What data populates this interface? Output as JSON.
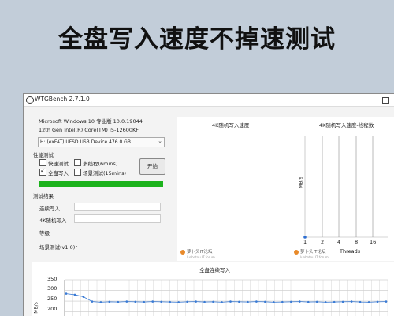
{
  "banner": {
    "title": "全盘写入速度不掉速测试"
  },
  "window": {
    "title": "WTGBench 2.7.1.0"
  },
  "system": {
    "os": "Microsoft Windows 10 专业版 10.0.19044",
    "cpu": "12th Gen Intel(R) Core(TM) i5-12600KF",
    "drive": "H:  (exFAT)   UFSD  USB Device 476.0 GB"
  },
  "test_type": {
    "section_label": "性能测试",
    "options": [
      {
        "label": "快速测试",
        "checked": false
      },
      {
        "label": "多线程(6mins)",
        "checked": false
      },
      {
        "label": "全盘写入",
        "checked": true
      },
      {
        "label": "场景测试(15mins)",
        "checked": false
      }
    ],
    "start_label": "开始",
    "progress": 1.0,
    "progress_color": "#1cb21c"
  },
  "results": {
    "section_label": "测试结果",
    "seq_write_label": "连续写入",
    "rand4k_write_label": "4K随机写入",
    "grade_label": "等级",
    "scene_label": "场景测试(v1.0)",
    "scene_value": "-"
  },
  "chart_4k": {
    "title": "4K随机写入速度"
  },
  "chart_threads": {
    "title": "4K随机写入速度-线程数",
    "ylabel": "MB/s",
    "xlabel": "Threads",
    "x_ticks": [
      "1",
      "2",
      "4",
      "8",
      "16"
    ]
  },
  "watermark": {
    "text": "萝卜头IT论坛",
    "sub": "luobotou IT forum"
  },
  "chart_data": [
    {
      "type": "line",
      "title": "全盘连续写入",
      "ylabel": "MB/s",
      "y_ticks": [
        "350",
        "300",
        "250",
        "200"
      ],
      "ylim": [
        180,
        350
      ],
      "series": [
        {
          "values": [
            285,
            280,
            270,
            248,
            245,
            247,
            246,
            248,
            247,
            246,
            248,
            247,
            246,
            245,
            247,
            248,
            246,
            247,
            245,
            248,
            247,
            246,
            248,
            247,
            245,
            246,
            247,
            248,
            246,
            247,
            245,
            246,
            247,
            248,
            246,
            245,
            247,
            248
          ]
        }
      ]
    },
    {
      "type": "scatter",
      "title": "4K随机写入速度-线程数",
      "xlabel": "Threads",
      "ylabel": "MB/s",
      "x": [
        1,
        2,
        4,
        8,
        16
      ],
      "series": [
        {
          "values": [
            0,
            null,
            null,
            null,
            null
          ]
        }
      ]
    }
  ]
}
